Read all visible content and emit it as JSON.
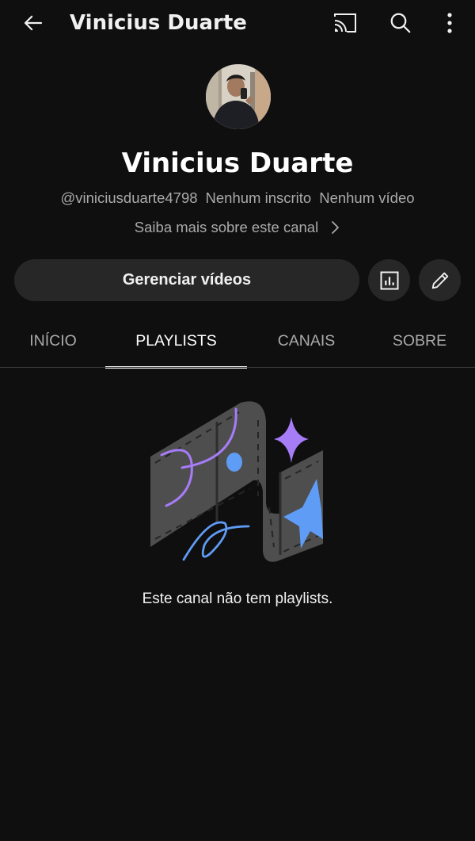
{
  "appbar": {
    "title": "Vinicius Duarte",
    "back_icon": "arrow-left-icon",
    "cast_icon": "cast-icon",
    "search_icon": "search-icon",
    "more_icon": "more-vert-icon"
  },
  "channel": {
    "name": "Vinicius Duarte",
    "handle": "@viniciusduarte4798",
    "subscribers": "Nenhum inscrito",
    "videos": "Nenhum vídeo",
    "about_link": "Saiba mais sobre este canal"
  },
  "actions": {
    "manage_label": "Gerenciar vídeos",
    "analytics_icon": "analytics-icon",
    "edit_icon": "pencil-icon"
  },
  "tabs": [
    {
      "label": "INÍCIO",
      "active": false
    },
    {
      "label": "PLAYLISTS",
      "active": true
    },
    {
      "label": "CANAIS",
      "active": false
    },
    {
      "label": "SOBRE",
      "active": false
    }
  ],
  "empty_state": {
    "message": "Este canal não tem playlists."
  },
  "colors": {
    "background": "#0f0f0f",
    "button_bg": "#272727",
    "text_primary": "#f1f1f1",
    "text_secondary": "#aaaaaa",
    "accent_purple": "#a67cf7",
    "accent_blue": "#5f9cf5"
  }
}
